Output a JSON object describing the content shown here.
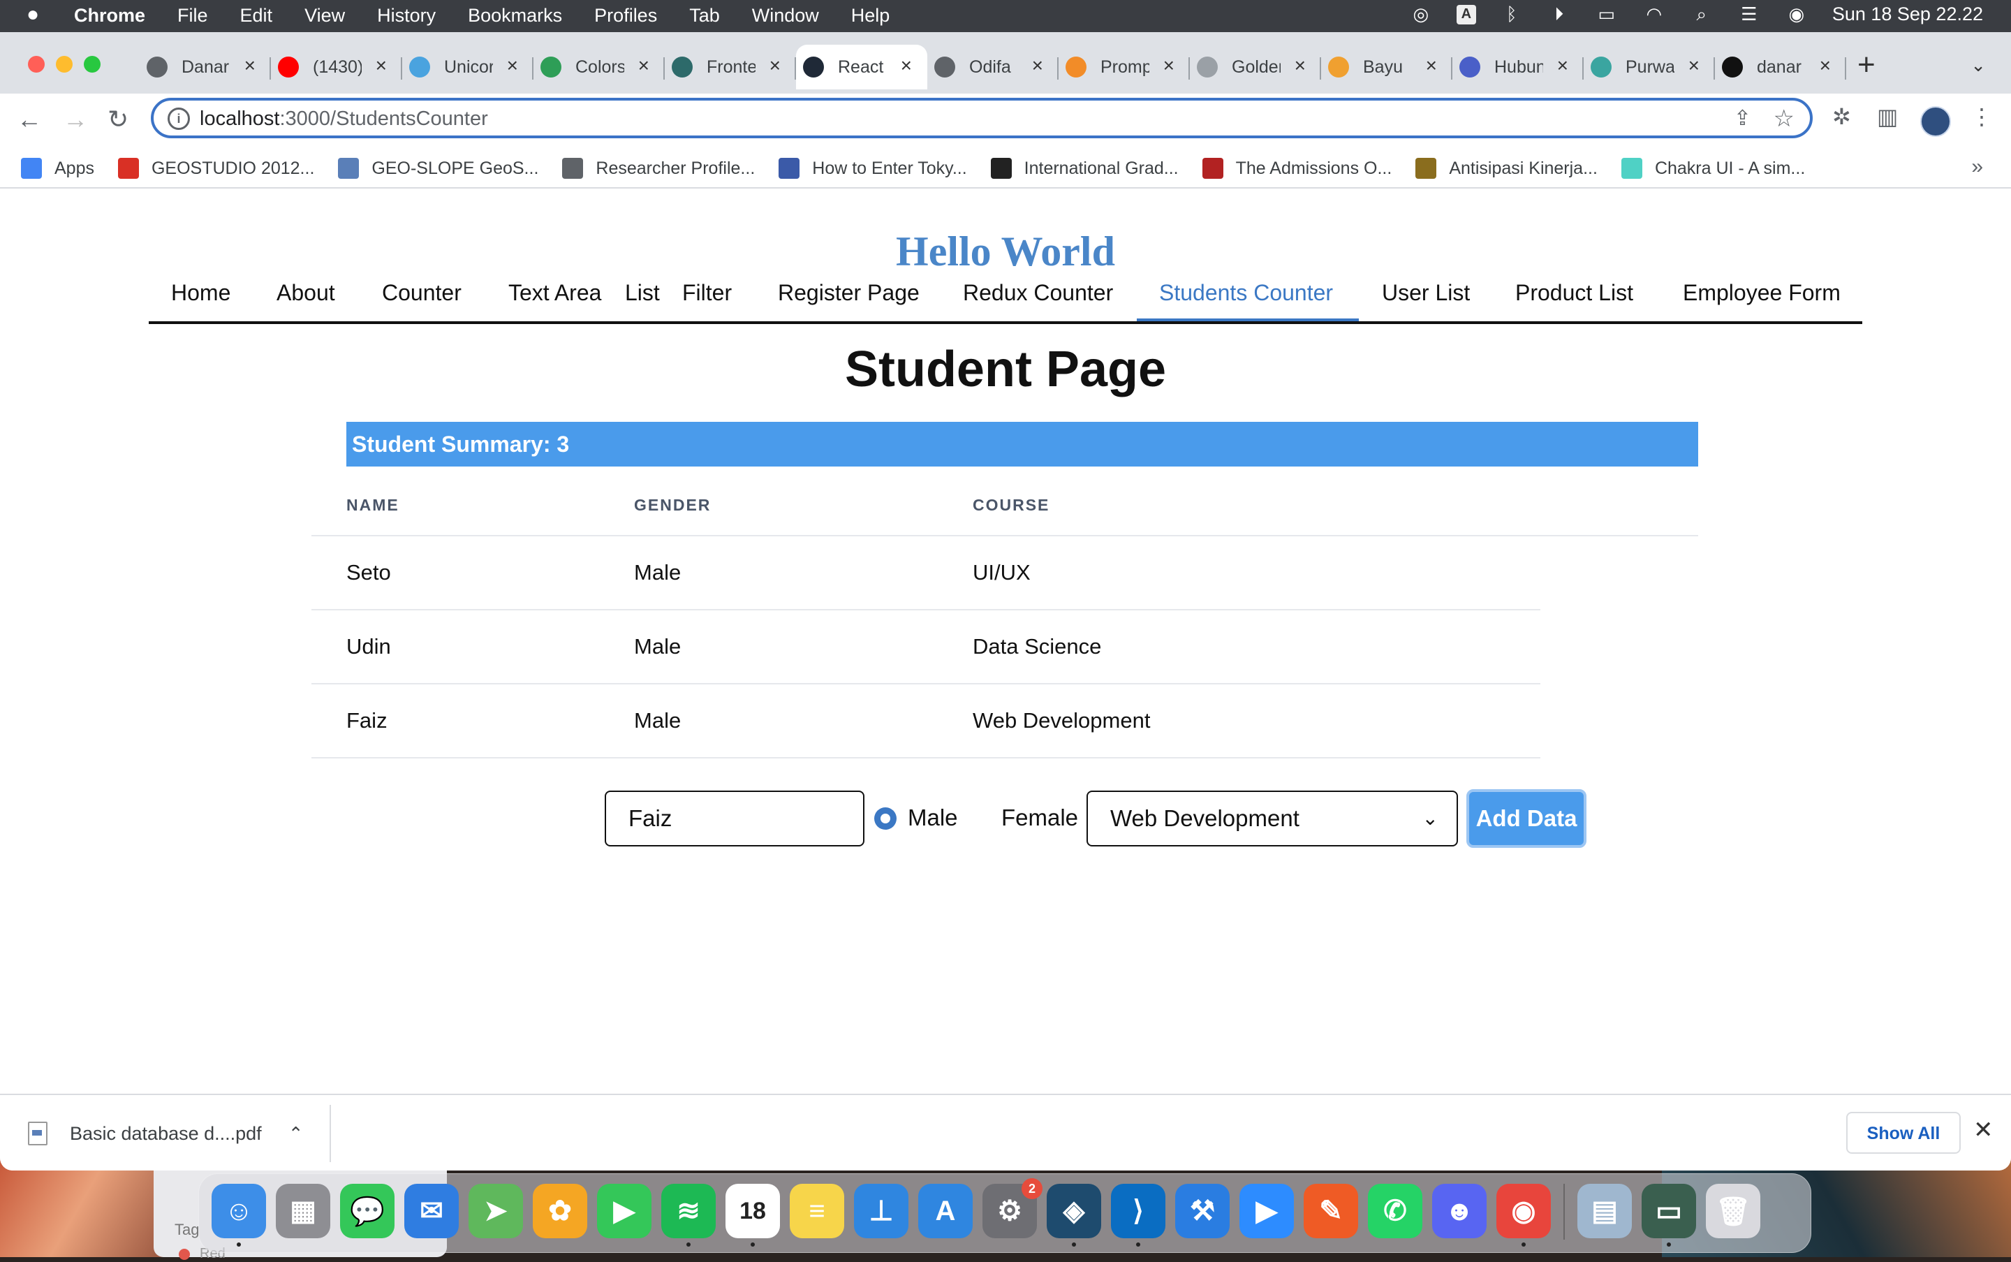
{
  "menubar": {
    "app": "Chrome",
    "menus": [
      "File",
      "Edit",
      "View",
      "History",
      "Bookmarks",
      "Profiles",
      "Tab",
      "Window",
      "Help"
    ],
    "datetime": "Sun 18 Sep  22.22"
  },
  "tabs": [
    {
      "title": "Danar",
      "icon": "globe-icon",
      "color": "#5f6368"
    },
    {
      "title": "(1430)",
      "icon": "youtube-icon",
      "color": "#ff0000"
    },
    {
      "title": "Unicorn",
      "icon": "search-icon",
      "color": "#4aa3df"
    },
    {
      "title": "Colors",
      "icon": "w-icon",
      "color": "#2e9e57"
    },
    {
      "title": "Frontend",
      "icon": "wix-icon",
      "color": "#2d6a6a"
    },
    {
      "title": "React",
      "icon": "react-icon",
      "color": "#1f2937"
    },
    {
      "title": "Odifa",
      "icon": "globe-icon",
      "color": "#5f6368"
    },
    {
      "title": "Prompt",
      "icon": "slides-icon",
      "color": "#f28c28"
    },
    {
      "title": "Golden",
      "icon": "cloud-icon",
      "color": "#9aa0a6"
    },
    {
      "title": "Bayu",
      "icon": "wave-icon",
      "color": "#f0a030"
    },
    {
      "title": "Hubungi",
      "icon": "shield-icon",
      "color": "#4a5fc8"
    },
    {
      "title": "Purwa",
      "icon": "purwa-icon",
      "color": "#3aa5a0"
    },
    {
      "title": "danar",
      "icon": "github-icon",
      "color": "#111111"
    }
  ],
  "url": {
    "host": "localhost",
    "path": ":3000/StudentsCounter"
  },
  "bookmarks": [
    {
      "label": "Apps",
      "icon": "apps-grid-icon",
      "color": "#4285f4"
    },
    {
      "label": "GEOSTUDIO 2012...",
      "icon": "geostudio-icon",
      "color": "#d93025"
    },
    {
      "label": "GEO-SLOPE GeoS...",
      "icon": "geoslope-icon",
      "color": "#5a7fb8"
    },
    {
      "label": "Researcher Profile...",
      "icon": "globe-icon",
      "color": "#5f6368"
    },
    {
      "label": "How to Enter Toky...",
      "icon": "tokyo-icon",
      "color": "#3b5aa8"
    },
    {
      "label": "International Grad...",
      "icon": "grad-icon",
      "color": "#222222"
    },
    {
      "label": "The Admissions O...",
      "icon": "admissions-icon",
      "color": "#b22222"
    },
    {
      "label": "Antisipasi Kinerja...",
      "icon": "emblem-icon",
      "color": "#8a6d1e"
    },
    {
      "label": "Chakra UI - A sim...",
      "icon": "chakra-icon",
      "color": "#4fd1c5"
    }
  ],
  "page": {
    "heading": "Hello World",
    "nav": [
      "Home",
      "About",
      "Counter",
      "Text Area",
      "List",
      "Filter",
      "Register Page",
      "Redux Counter",
      "Students Counter",
      "User List",
      "Product List",
      "Employee Form"
    ],
    "active_nav": "Students Counter",
    "title": "Student Page",
    "summary": "Student Summary: 3",
    "columns": [
      "NAME",
      "GENDER",
      "COURSE"
    ],
    "rows": [
      {
        "name": "Seto",
        "gender": "Male",
        "course": "UI/UX"
      },
      {
        "name": "Udin",
        "gender": "Male",
        "course": "Data Science"
      },
      {
        "name": "Faiz",
        "gender": "Male",
        "course": "Web Development"
      }
    ],
    "form": {
      "name_value": "Faiz",
      "gender_male": "Male",
      "gender_female": "Female",
      "selected_gender": "Male",
      "course_value": "Web Development",
      "submit": "Add Data"
    },
    "accent": "#4a9beb"
  },
  "download": {
    "file": "Basic database d....pdf",
    "show_all": "Show All"
  },
  "dock": [
    {
      "name": "finder-icon",
      "color": "#3d8ee8",
      "glyph": "☺"
    },
    {
      "name": "launchpad-icon",
      "color": "#8e8e93",
      "glyph": "▦"
    },
    {
      "name": "messages-icon",
      "color": "#34c759",
      "glyph": "💬"
    },
    {
      "name": "mail-icon",
      "color": "#2f7de1",
      "glyph": "✉"
    },
    {
      "name": "maps-icon",
      "color": "#5fb85c",
      "glyph": "➤"
    },
    {
      "name": "photos-icon",
      "color": "#f5a623",
      "glyph": "✿"
    },
    {
      "name": "facetime-icon",
      "color": "#34c759",
      "glyph": "▶"
    },
    {
      "name": "spotify-icon",
      "color": "#1db954",
      "glyph": "≋"
    },
    {
      "name": "calendar-icon",
      "color": "#ffffff",
      "glyph": "18"
    },
    {
      "name": "notes-icon",
      "color": "#f7d54a",
      "glyph": "≡"
    },
    {
      "name": "keynote-icon",
      "color": "#2f86e0",
      "glyph": "⊥"
    },
    {
      "name": "app-store-icon",
      "color": "#2f86e0",
      "glyph": "A"
    },
    {
      "name": "system-preferences-icon",
      "color": "#6e6e73",
      "glyph": "⚙",
      "badge": "2"
    },
    {
      "name": "mysql-workbench-icon",
      "color": "#1e4b6e",
      "glyph": "◈"
    },
    {
      "name": "vscode-icon",
      "color": "#0a6dc2",
      "glyph": "⟩"
    },
    {
      "name": "xcode-icon",
      "color": "#2a7de1",
      "glyph": "⚒"
    },
    {
      "name": "zoom-icon",
      "color": "#2d8cff",
      "glyph": "▶"
    },
    {
      "name": "postman-icon",
      "color": "#ef5b25",
      "glyph": "✎"
    },
    {
      "name": "whatsapp-icon",
      "color": "#25d366",
      "glyph": "✆"
    },
    {
      "name": "discord-icon",
      "color": "#5865f2",
      "glyph": "☻"
    },
    {
      "name": "chrome-icon",
      "color": "#e8453c",
      "glyph": "◉"
    },
    {
      "name": "preview-icon",
      "color": "#9fb7cf",
      "glyph": "▤"
    },
    {
      "name": "downloads-stack-icon",
      "color": "#3a5f4f",
      "glyph": "▭"
    },
    {
      "name": "trash-icon",
      "color": "#d9d9de",
      "glyph": "🗑"
    }
  ]
}
